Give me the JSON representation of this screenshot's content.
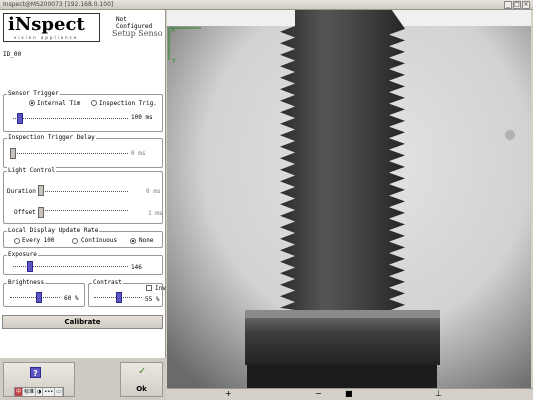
{
  "window": {
    "title": "Inspect@MS200073 [192.168.0.100]",
    "minimize": "_",
    "maximize": "□",
    "close": "×"
  },
  "header": {
    "logo_text": "iNspect",
    "logo_tagline": "vision appliance",
    "status": "Not Configured",
    "mode": "Setup Senso",
    "sensor_id": "ID_00"
  },
  "sensor_trigger": {
    "legend": "Sensor Trigger",
    "options": [
      "Internal Tim",
      "Inspection Trig."
    ],
    "selected": 0,
    "value": "100 ms",
    "level": 0.05
  },
  "trigger_delay": {
    "legend": "Inspection Trigger Delay",
    "value": "0 ms",
    "level": 0.0
  },
  "light_control": {
    "legend": "Light Control",
    "duration_label": "Duration",
    "duration_value": "0 ms",
    "duration_level": 0.0,
    "offset_label": "Offset",
    "offset_value": "1 ms",
    "offset_level": 0.0
  },
  "display_update": {
    "legend": "Local Display Update Rate",
    "options": [
      "Every 100",
      "Continuous",
      "None"
    ],
    "selected": 2
  },
  "exposure": {
    "legend": "Exposure",
    "value": "146",
    "level": 0.15
  },
  "brightness": {
    "legend": "Brightness",
    "value": "60 %",
    "level": 0.6
  },
  "contrast": {
    "legend": "Contrast",
    "value": "55 %",
    "level": 0.55,
    "checkbox_label": "Inv"
  },
  "buttons": {
    "calibrate": "Calibrate",
    "help": "?",
    "ok": "Ok"
  },
  "ime": [
    "中",
    "标准",
    "◑",
    "•••",
    "▭"
  ],
  "image_view": {
    "axis_x": "X",
    "axis_y": "Y"
  },
  "statusbar": [
    "+",
    "−",
    "■",
    "⊥"
  ],
  "colors": {
    "accent": "#5d55c2",
    "axis": "#2a8a2a",
    "ok_check": "#4c8a2e"
  }
}
